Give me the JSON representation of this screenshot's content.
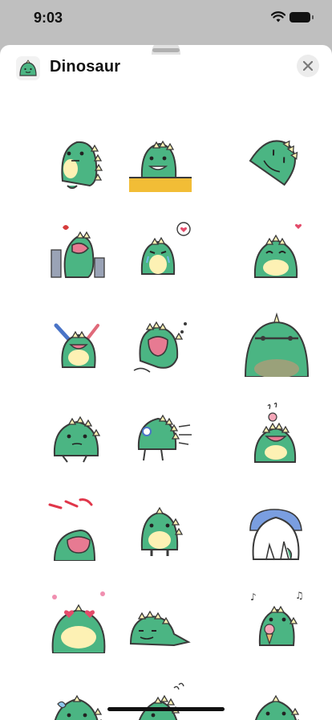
{
  "status_bar": {
    "time": "9:03",
    "icons": [
      "wifi-icon",
      "battery-icon"
    ]
  },
  "sheet": {
    "title": "Dinosaur",
    "close_icon": "close-icon"
  },
  "colors": {
    "dino_body": "#4bb583",
    "dino_belly": "#fdf1b4",
    "outline": "#3a3a3a",
    "tabletop": "#f2bd36",
    "heart": "#e34b6a",
    "bat": "#4a74c7"
  },
  "stickers": [
    {
      "id": 1,
      "icon": "dinosaur-sad-sitting-sticker"
    },
    {
      "id": 2,
      "icon": "dinosaur-at-table-sticker"
    },
    {
      "id": 3,
      "icon": "dinosaur-tumbling-sticker"
    },
    {
      "id": 4,
      "icon": "dinosaur-roaring-city-sticker"
    },
    {
      "id": 5,
      "icon": "dinosaur-crying-heart-sticker"
    },
    {
      "id": 6,
      "icon": "dinosaur-love-heart-sticker"
    },
    {
      "id": 7,
      "icon": "dinosaur-baseball-bat-sticker"
    },
    {
      "id": 8,
      "icon": "dinosaur-screaming-jump-sticker"
    },
    {
      "id": 9,
      "icon": "dinosaur-big-peek-sticker"
    },
    {
      "id": 10,
      "icon": "dinosaur-thinking-sticker"
    },
    {
      "id": 11,
      "icon": "dinosaur-running-sticker"
    },
    {
      "id": 12,
      "icon": "dinosaur-eating-cake-sticker"
    },
    {
      "id": 13,
      "icon": "dinosaur-shocked-peek-sticker"
    },
    {
      "id": 14,
      "icon": "dinosaur-standing-sticker"
    },
    {
      "id": 15,
      "icon": "dinosaur-sleeping-blanket-sticker"
    },
    {
      "id": 16,
      "icon": "dinosaur-heart-eyes-sticker"
    },
    {
      "id": 17,
      "icon": "dinosaur-lying-down-sticker"
    },
    {
      "id": 18,
      "icon": "dinosaur-ice-cream-music-sticker"
    },
    {
      "id": 19,
      "icon": "dinosaur-sweating-sticker"
    },
    {
      "id": 20,
      "icon": "dinosaur-looking-back-sticker"
    },
    {
      "id": 21,
      "icon": "dinosaur-eating-sticker"
    }
  ]
}
